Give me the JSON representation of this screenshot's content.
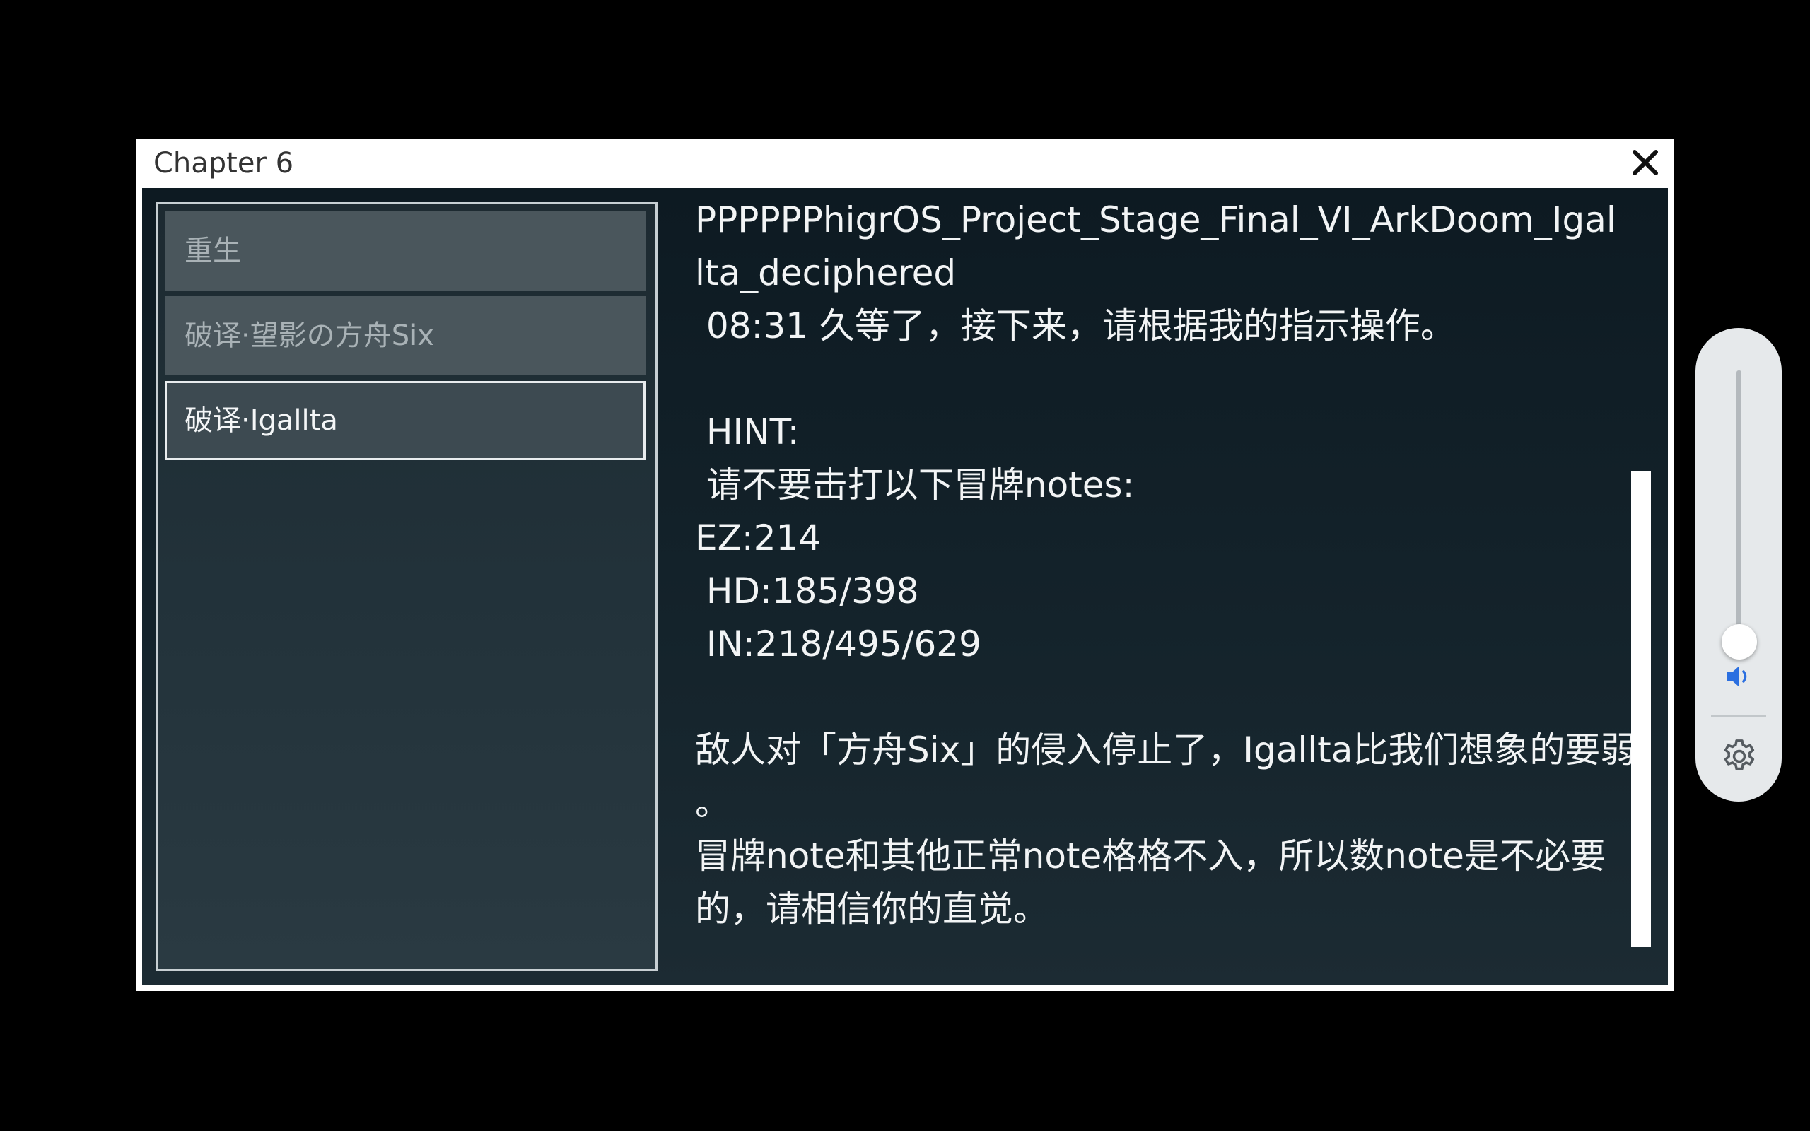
{
  "dialog": {
    "title": "Chapter 6",
    "close_icon": "close-icon"
  },
  "songs": [
    {
      "label": "重生",
      "selected": false
    },
    {
      "label": "破译·望影の方舟Six",
      "selected": false
    },
    {
      "label": "破译·Igallta",
      "selected": true
    }
  ],
  "description": {
    "lines": [
      "PPPPPPhigrOS_Project_Stage_Final_VI_ArkDoom_Igal",
      "lta_deciphered",
      " 08:31 久等了，接下来，请根据我的指示操作。",
      "",
      " HINT:",
      " 请不要击打以下冒牌notes:",
      "EZ:214",
      " HD:185/398",
      " IN:218/495/629",
      "",
      "敌人对「方舟Six」的侵入停止了，Igallta比我们想象的要弱",
      "。",
      "冒牌note和其他正常note格格不入，所以数note是不必要",
      "的，请相信你的直觉。"
    ]
  },
  "volume": {
    "level": 0.03,
    "speaker_icon": "speaker-icon",
    "settings_icon": "gear-icon",
    "accent_color": "#2b6fe0"
  }
}
